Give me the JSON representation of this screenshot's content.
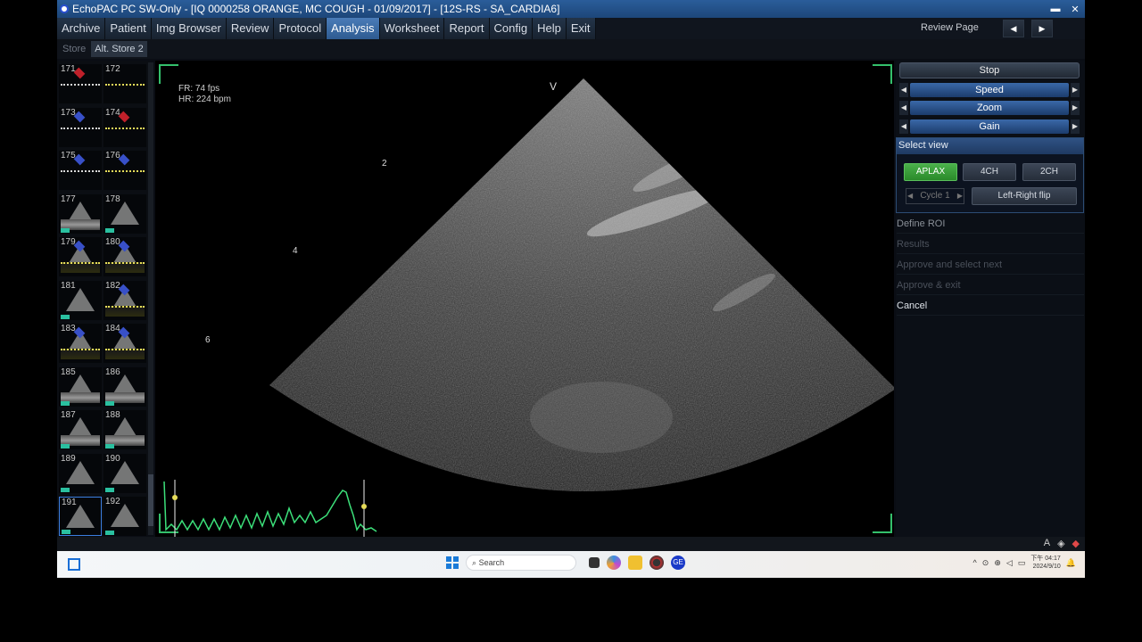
{
  "window": {
    "title": "EchoPAC PC SW-Only - [IQ 0000258 ORANGE, MC COUGH  - 01/09/2017] - [12S-RS - SA_CARDIA6]",
    "minimize_icon": "minimize-icon",
    "close_icon": "close-icon"
  },
  "menu": {
    "items": [
      "Archive",
      "Patient",
      "Img Browser",
      "Review",
      "Protocol",
      "Analysis",
      "Worksheet",
      "Report",
      "Config",
      "Help",
      "Exit"
    ],
    "active": "Analysis",
    "review_page_label": "Review Page",
    "prev_icon": "prev-page-icon",
    "next_icon": "next-page-icon"
  },
  "submenu": {
    "tabs": [
      "Store",
      "Alt. Store 2"
    ],
    "active": "Alt. Store 2"
  },
  "thumbnails": [
    {
      "num": "171",
      "kind": "color-wave"
    },
    {
      "num": "172",
      "kind": "wave"
    },
    {
      "num": "173",
      "kind": "color-wave"
    },
    {
      "num": "174",
      "kind": "color-wave"
    },
    {
      "num": "175",
      "kind": "color-wave"
    },
    {
      "num": "176",
      "kind": "color-wave"
    },
    {
      "num": "177",
      "kind": "sector-doppler"
    },
    {
      "num": "178",
      "kind": "sector"
    },
    {
      "num": "179",
      "kind": "color-doppler"
    },
    {
      "num": "180",
      "kind": "color-doppler"
    },
    {
      "num": "181",
      "kind": "sector"
    },
    {
      "num": "182",
      "kind": "color-doppler"
    },
    {
      "num": "183",
      "kind": "color-doppler"
    },
    {
      "num": "184",
      "kind": "color-doppler"
    },
    {
      "num": "185",
      "kind": "sector-doppler"
    },
    {
      "num": "186",
      "kind": "sector-doppler"
    },
    {
      "num": "187",
      "kind": "sector-doppler"
    },
    {
      "num": "188",
      "kind": "sector-doppler"
    },
    {
      "num": "189",
      "kind": "sector"
    },
    {
      "num": "190",
      "kind": "sector"
    },
    {
      "num": "191",
      "kind": "sector",
      "selected": true
    },
    {
      "num": "192",
      "kind": "sector"
    }
  ],
  "image": {
    "fr": "FR: 74 fps",
    "hr": "HR: 224 bpm",
    "v_marker": "V",
    "depth_marks": [
      "2",
      "4",
      "6"
    ]
  },
  "panel": {
    "stop_label": "Stop",
    "sliders": [
      "Speed",
      "Zoom",
      "Gain"
    ],
    "select_view": {
      "header": "Select view",
      "views": [
        "APLAX",
        "4CH",
        "2CH"
      ],
      "active_view": "APLAX",
      "cycle": "Cycle 1",
      "flip_label": "Left-Right flip"
    },
    "items": [
      {
        "label": "Define ROI",
        "state": "semi"
      },
      {
        "label": "Results",
        "state": "disabled"
      },
      {
        "label": "Approve and select next",
        "state": "disabled"
      },
      {
        "label": "Approve & exit",
        "state": "disabled"
      },
      {
        "label": "Cancel",
        "state": "enabled"
      }
    ]
  },
  "statusbar": {
    "icons": [
      "font-icon",
      "eraser-icon",
      "tool-icon"
    ],
    "font_glyph": "A"
  },
  "taskbar": {
    "search_placeholder": "Search",
    "clock_ampm": "下午 04:17",
    "clock_date": "2024/9/10",
    "apps": [
      "file-explorer-icon",
      "copilot-icon",
      "folder-icon",
      "chrome-icon",
      "ge-icon"
    ]
  },
  "colors": {
    "accent_blue": "#2e5b91",
    "active_green": "#3aa23a",
    "ecg_trace": "#3ce07a",
    "frame_corner": "#34c06c"
  }
}
